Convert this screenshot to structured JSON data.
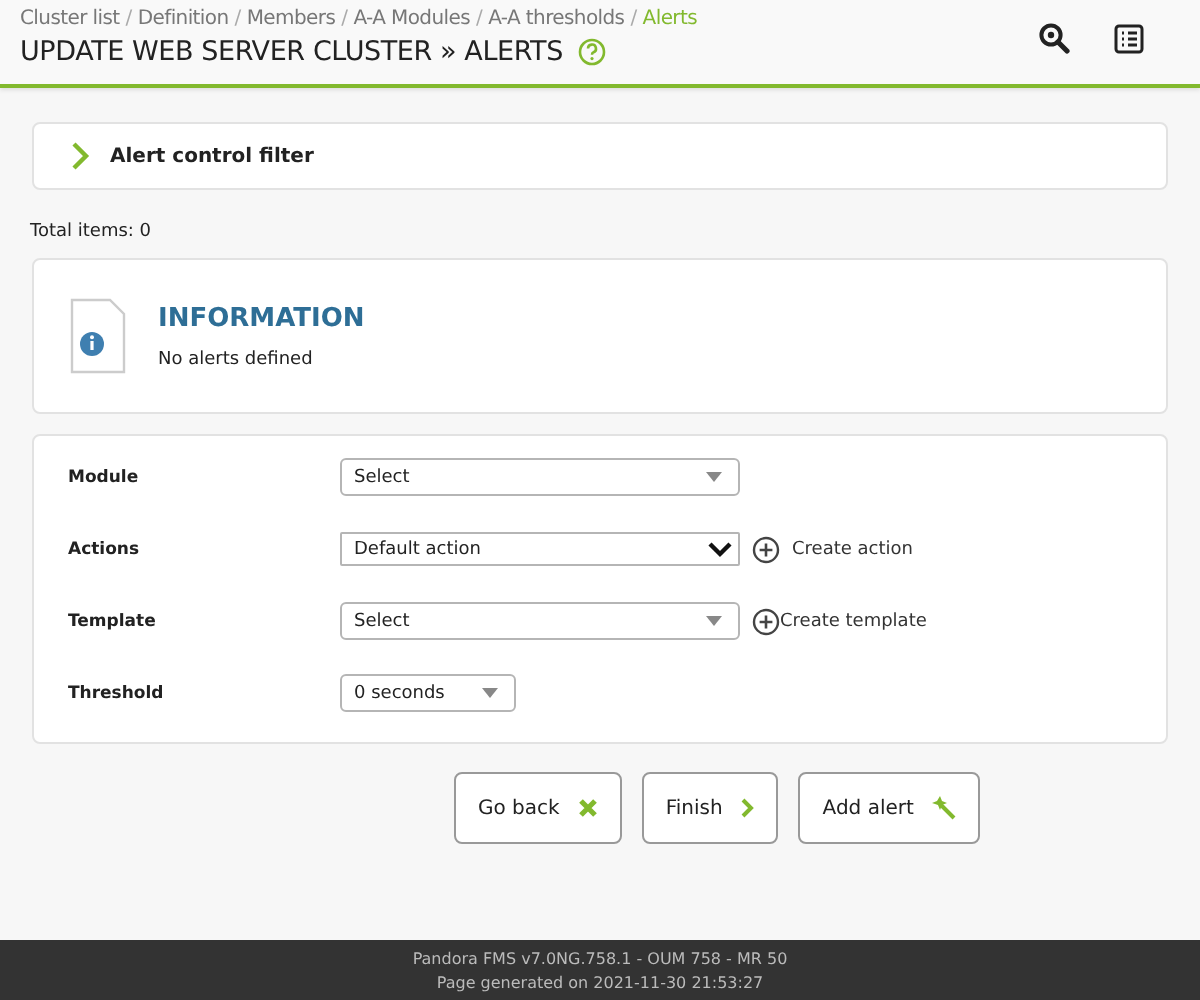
{
  "breadcrumbs": [
    {
      "label": "Cluster list",
      "selected": false
    },
    {
      "label": "Definition",
      "selected": false
    },
    {
      "label": "Members",
      "selected": false
    },
    {
      "label": "A-A Modules",
      "selected": false
    },
    {
      "label": "A-A thresholds",
      "selected": false
    },
    {
      "label": "Alerts",
      "selected": true
    }
  ],
  "breadcrumb_separator": "/",
  "title": "UPDATE WEB SERVER CLUSTER » ALERTS",
  "filter": {
    "label": "Alert control filter",
    "expanded": false
  },
  "total_items": "Total items: 0",
  "info": {
    "title": "INFORMATION",
    "message": "No alerts defined"
  },
  "form": [
    {
      "label": "Module",
      "kind": "select",
      "value": "Select"
    },
    {
      "label": "Actions",
      "kind": "native",
      "value": "Default action",
      "link": "Create action"
    },
    {
      "label": "Template",
      "kind": "select",
      "value": "Select",
      "link": "Create template"
    },
    {
      "label": "Threshold",
      "kind": "select",
      "value": "0 seconds"
    }
  ],
  "buttons": [
    {
      "label": "Go back",
      "kind": "cross"
    },
    {
      "label": "Finish",
      "kind": "next"
    },
    {
      "label": "Add alert",
      "kind": "wand"
    }
  ],
  "footer": [
    "Pandora FMS v7.0NG.758.1 - OUM 758 - MR 50",
    "Page generated on 2021-11-30 21:53:27"
  ]
}
